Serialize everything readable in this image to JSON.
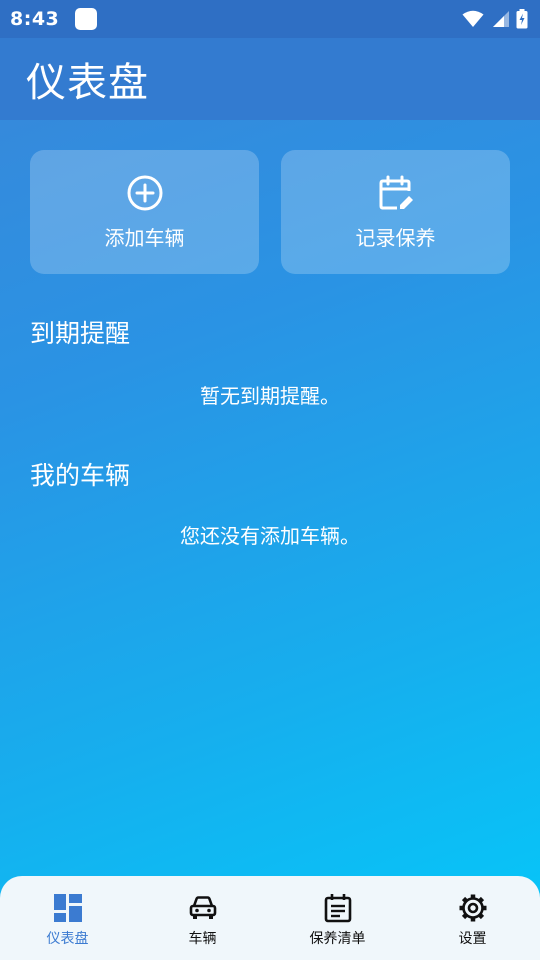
{
  "status_bar": {
    "time": "8:43"
  },
  "app_bar": {
    "title": "仪表盘"
  },
  "actions": [
    {
      "label": "添加车辆",
      "icon": "add-circle-icon"
    },
    {
      "label": "记录保养",
      "icon": "calendar-edit-icon"
    }
  ],
  "reminders": {
    "title": "到期提醒",
    "empty_text": "暂无到期提醒。"
  },
  "vehicles": {
    "title": "我的车辆",
    "empty_text": "您还没有添加车辆。"
  },
  "bottom_nav": {
    "items": [
      {
        "label": "仪表盘",
        "icon": "dashboard-icon",
        "active": true
      },
      {
        "label": "车辆",
        "icon": "car-icon",
        "active": false
      },
      {
        "label": "保养清单",
        "icon": "checklist-icon",
        "active": false
      },
      {
        "label": "设置",
        "icon": "gear-icon",
        "active": false
      }
    ]
  },
  "colors": {
    "active_accent": "#3b7bd1",
    "app_bar": "#337bd0",
    "nav_background": "#f0f7fb"
  }
}
